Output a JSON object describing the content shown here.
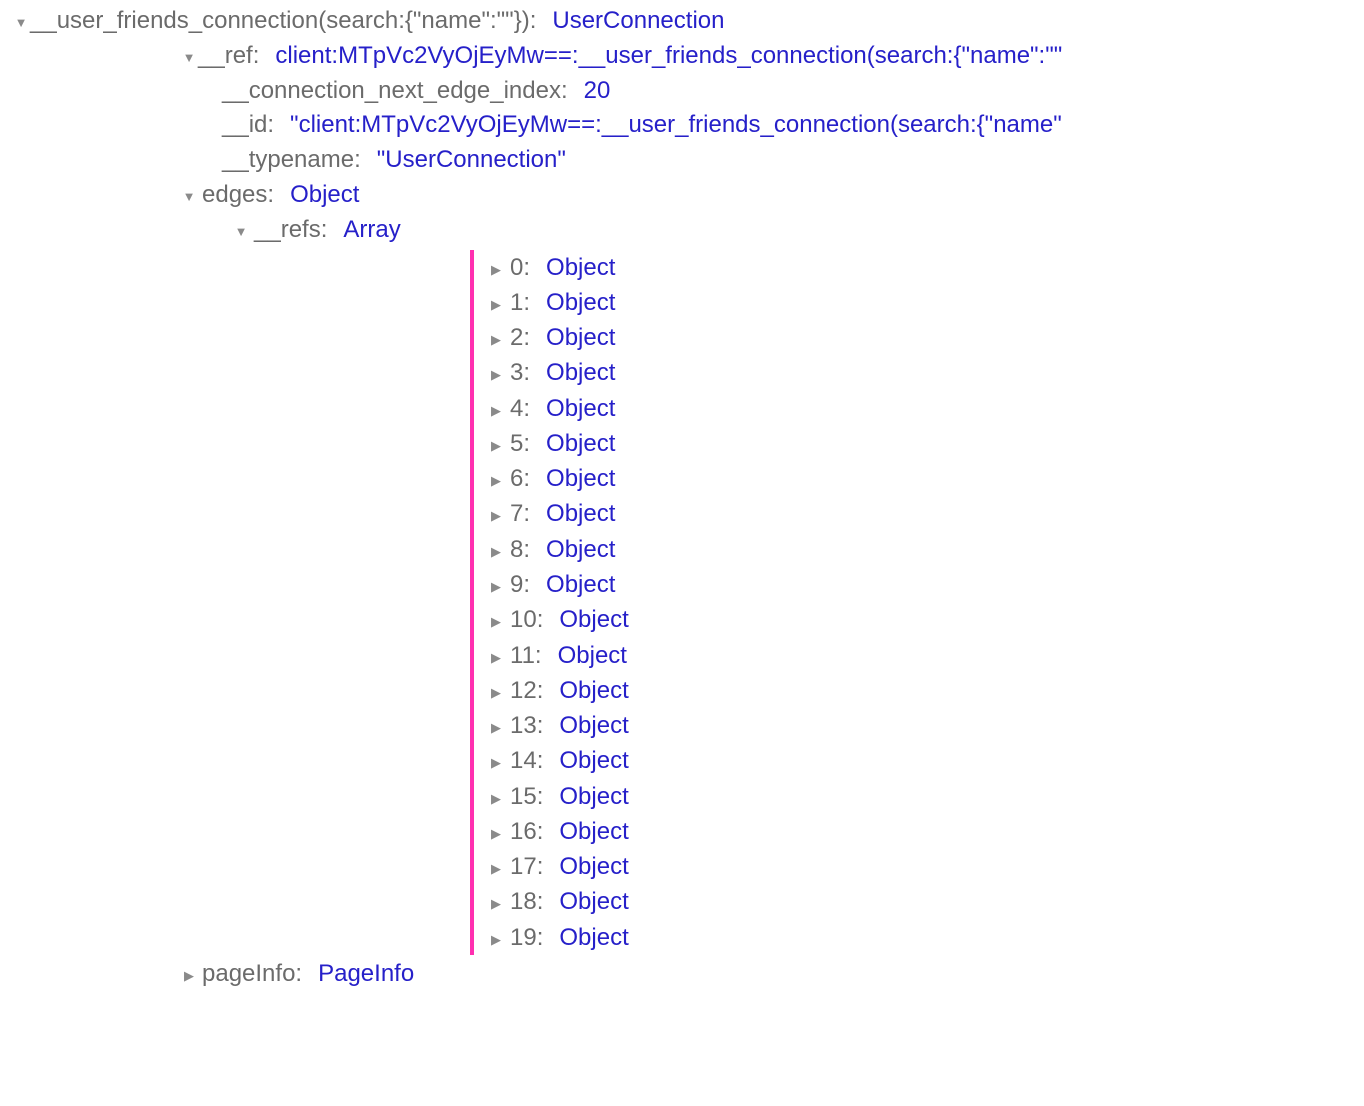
{
  "root": {
    "key": "__user_friends_connection(search:{\"name\":\"\"})",
    "value": "UserConnection"
  },
  "ref": {
    "key": "__ref",
    "value": "client:MTpVc2VyOjEyMw==:__user_friends_connection(search:{\"name\":\"\""
  },
  "next_edge": {
    "key": "__connection_next_edge_index",
    "value": "20"
  },
  "id_field": {
    "key": "__id",
    "value": "\"client:MTpVc2VyOjEyMw==:__user_friends_connection(search:{\"name\""
  },
  "typename": {
    "key": "__typename",
    "value": "\"UserConnection\""
  },
  "edges": {
    "key": "edges",
    "value": "Object"
  },
  "refs": {
    "key": "__refs",
    "value": "Array"
  },
  "refs_items": [
    {
      "key": "0",
      "value": "Object"
    },
    {
      "key": "1",
      "value": "Object"
    },
    {
      "key": "2",
      "value": "Object"
    },
    {
      "key": "3",
      "value": "Object"
    },
    {
      "key": "4",
      "value": "Object"
    },
    {
      "key": "5",
      "value": "Object"
    },
    {
      "key": "6",
      "value": "Object"
    },
    {
      "key": "7",
      "value": "Object"
    },
    {
      "key": "8",
      "value": "Object"
    },
    {
      "key": "9",
      "value": "Object"
    },
    {
      "key": "10",
      "value": "Object"
    },
    {
      "key": "11",
      "value": "Object"
    },
    {
      "key": "12",
      "value": "Object"
    },
    {
      "key": "13",
      "value": "Object"
    },
    {
      "key": "14",
      "value": "Object"
    },
    {
      "key": "15",
      "value": "Object"
    },
    {
      "key": "16",
      "value": "Object"
    },
    {
      "key": "17",
      "value": "Object"
    },
    {
      "key": "18",
      "value": "Object"
    },
    {
      "key": "19",
      "value": "Object"
    }
  ],
  "pageInfo": {
    "key": "pageInfo",
    "value": "PageInfo"
  }
}
